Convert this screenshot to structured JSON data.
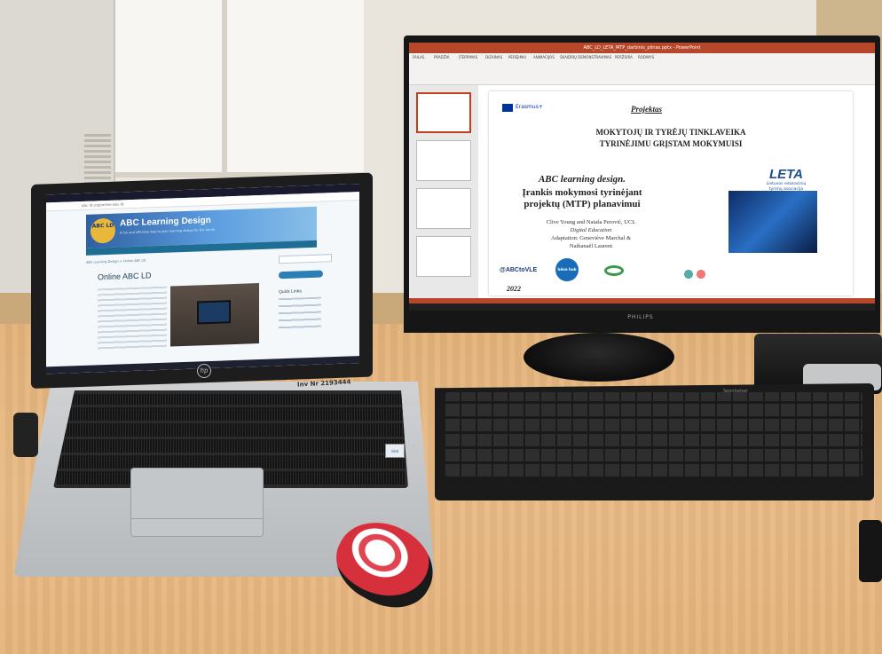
{
  "monitor": {
    "brand": "PHILIPS",
    "app_title": "ABC_LD_LETA_MTP_darbinis_pilnas.pptx - PowerPoint",
    "ribbon_tabs": [
      "FAILAS",
      "PRADŽIA",
      "ĮTERPIMAS",
      "DIZAINAS",
      "PERĖJIMAI",
      "ANIMACIJOS",
      "SKAIDRIŲ DEMONSTRAVIMAS",
      "PERŽIŪRA",
      "RODINYS"
    ],
    "slide": {
      "erasmus_label": "Erasmus+",
      "heading": "Projektas",
      "title_line1": "MOKYTOJŲ IR TYRĖJŲ TINKLAVEIKA",
      "title_line2": "TYRINĖJIMU GRĮSTAM MOKYMUISI",
      "abc_title": "ABC learning design.",
      "tool_line1": "Įrankis mokymosi tyrinėjant",
      "tool_line2": "projektų (MTP) planavimui",
      "authors_line1": "Clive Young and Nataša Perović, UCL",
      "authors_line2": "Digital Education",
      "authors_line3": "Adaptation: Geneviève Marchal &",
      "authors_line4": "Nathanaël Laurent",
      "leta_logo": "LETA",
      "leta_sub1": "Lietuvos edukacinių",
      "leta_sub2": "tyrimų asociacija",
      "handle": "@ABCtoVLE",
      "hub_label": "hėna hub",
      "year": "2022"
    }
  },
  "laptop": {
    "address": "abc-ld.org/online-abc-ld",
    "banner_logo": "ABC LD",
    "banner_title": "ABC Learning Design",
    "banner_sub": "A fun and effective way to plan learning design for the future",
    "breadcrumb": "ABC Learning Design > Online ABC LD",
    "page_heading": "Online ABC LD",
    "quick_links": "Quick Links",
    "brand_logo": "hp",
    "inventory_tag": "Inv Nr 2193444"
  },
  "keyboard": {
    "brand": "Sennheiser"
  }
}
